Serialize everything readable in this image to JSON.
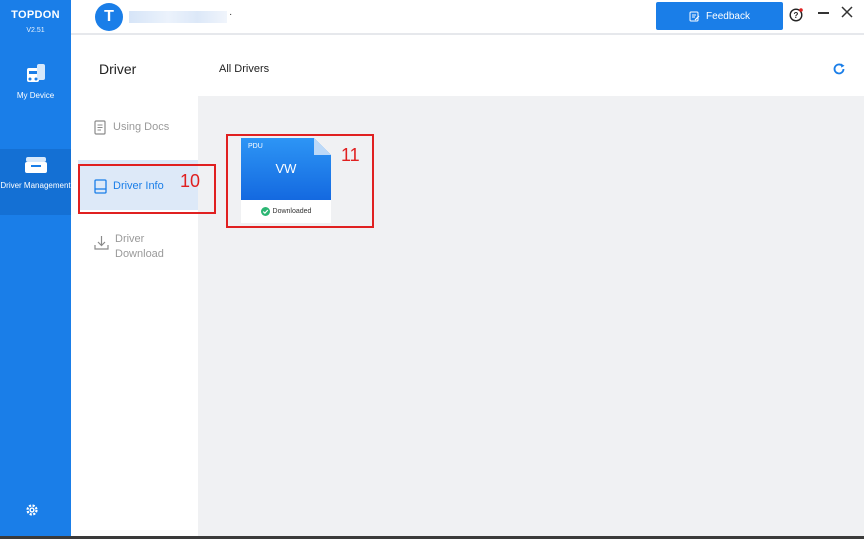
{
  "app": {
    "brand": "TOPDON",
    "version": "V2.51",
    "avatar_letter": "T",
    "username_suffix": "·"
  },
  "rail": {
    "items": [
      {
        "label": "My Device",
        "icon": "car-device-icon"
      },
      {
        "label": "Driver Management",
        "icon": "driver-folder-icon",
        "active": true
      }
    ],
    "settings_icon": "gear-icon"
  },
  "topbar": {
    "feedback_label": "Feedback"
  },
  "page": {
    "title": "Driver",
    "section_title": "All Drivers"
  },
  "submenu": {
    "items": [
      {
        "label": "Using Docs",
        "icon": "document-icon"
      },
      {
        "label": "Driver Info",
        "icon": "driver-info-icon",
        "active": true
      },
      {
        "label": "Driver Download",
        "icon": "download-icon"
      }
    ]
  },
  "drivers": [
    {
      "tag": "PDU",
      "name": "VW",
      "status": "Downloaded"
    }
  ],
  "annotations": [
    {
      "number": "10"
    },
    {
      "number": "11"
    }
  ],
  "colors": {
    "accent": "#1a7ee8",
    "annotation": "#e02020",
    "success": "#2bb673"
  }
}
